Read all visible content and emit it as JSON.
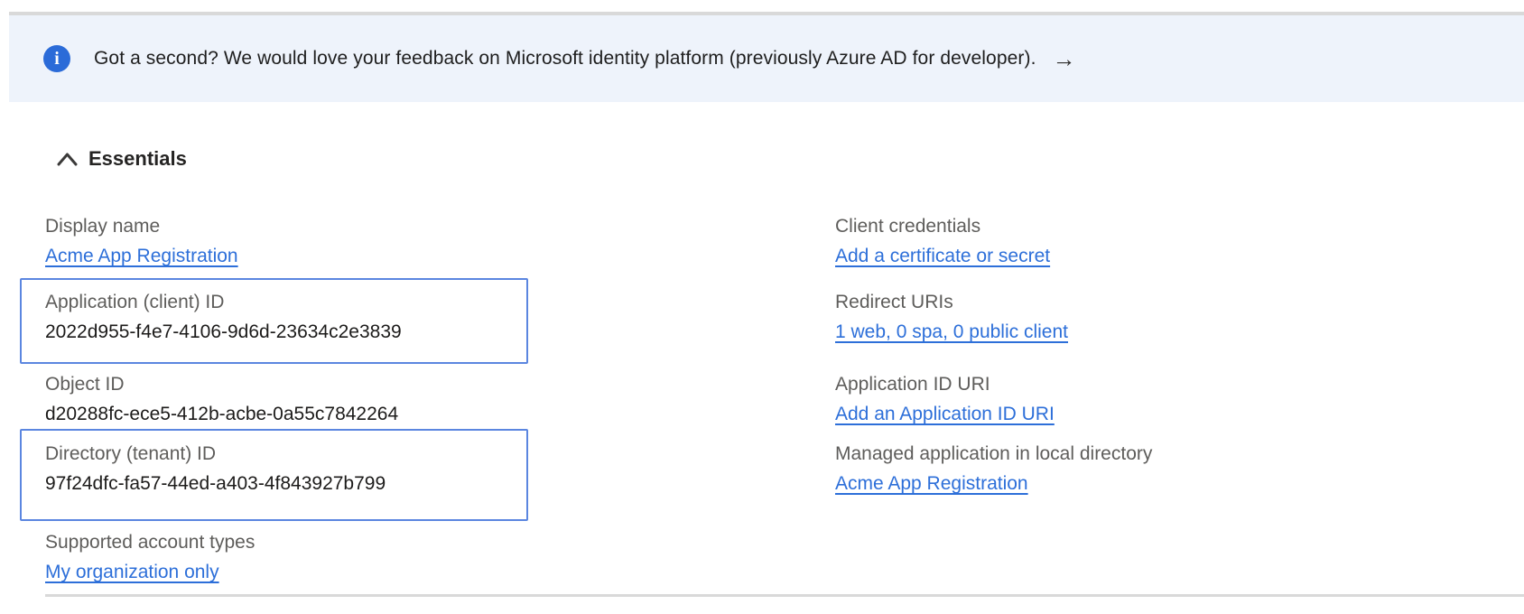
{
  "banner": {
    "text": "Got a second? We would love your feedback on Microsoft identity platform (previously Azure AD for developer).",
    "arrow": "→",
    "icon": "info-icon",
    "icon_glyph": "i",
    "background": "#eef3fb",
    "icon_color": "#2b6bd8"
  },
  "essentials": {
    "title": "Essentials",
    "left": [
      {
        "label": "Display name",
        "value": "Acme App Registration",
        "type": "link"
      },
      {
        "label": "Application (client) ID",
        "value": "2022d955-f4e7-4106-9d6d-23634c2e3839",
        "type": "text",
        "highlighted": true
      },
      {
        "label": "Object ID",
        "value": "d20288fc-ece5-412b-acbe-0a55c7842264",
        "type": "text"
      },
      {
        "label": "Directory (tenant) ID",
        "value": "97f24dfc-fa57-44ed-a403-4f843927b799",
        "type": "text",
        "highlighted": true
      },
      {
        "label": "Supported account types",
        "value": "My organization only",
        "type": "link"
      }
    ],
    "right": [
      {
        "label": "Client credentials",
        "value": "Add a certificate or secret",
        "type": "link"
      },
      {
        "label": "Redirect URIs",
        "value": "1 web, 0 spa, 0 public client",
        "type": "link"
      },
      {
        "label": "Application ID URI",
        "value": "Add an Application ID URI",
        "type": "link"
      },
      {
        "label": "Managed application in local directory",
        "value": "Acme App Registration",
        "type": "link"
      }
    ]
  },
  "colors": {
    "link": "#2d6fd9",
    "label": "#5e5d5b",
    "value": "#1c1b1a",
    "highlight_border": "#5b86e0",
    "divider": "#d9d9d9"
  }
}
